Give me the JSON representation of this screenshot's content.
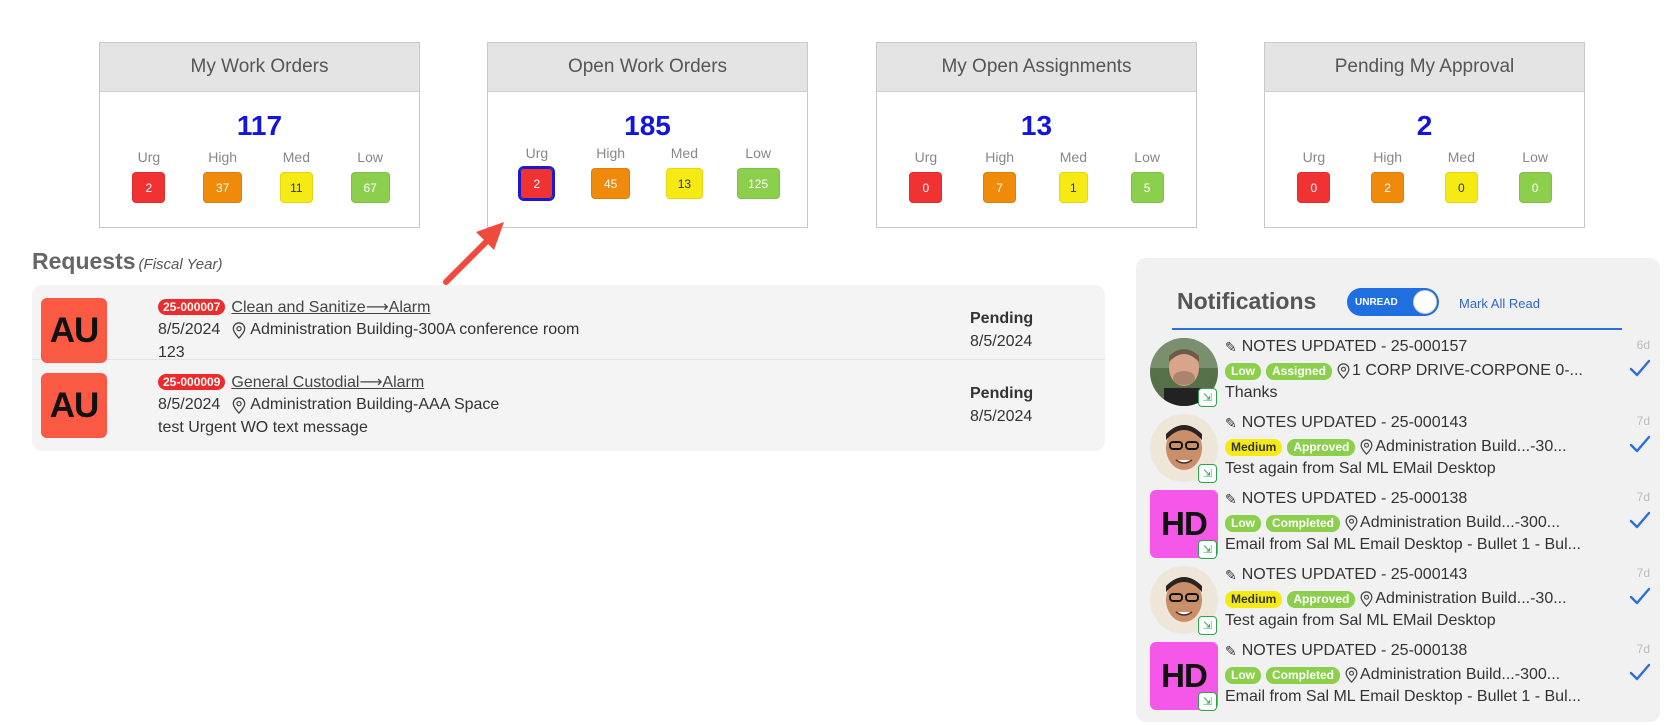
{
  "cards": [
    {
      "title": "My Work Orders",
      "total": "117",
      "labels": [
        "Urg",
        "High",
        "Med",
        "Low"
      ],
      "values": [
        "2",
        "37",
        "11",
        "67"
      ]
    },
    {
      "title": "Open Work Orders",
      "total": "185",
      "labels": [
        "Urg",
        "High",
        "Med",
        "Low"
      ],
      "values": [
        "2",
        "45",
        "13",
        "125"
      ]
    },
    {
      "title": "My Open Assignments",
      "total": "13",
      "labels": [
        "Urg",
        "High",
        "Med",
        "Low"
      ],
      "values": [
        "0",
        "7",
        "1",
        "5"
      ]
    },
    {
      "title": "Pending My Approval",
      "total": "2",
      "labels": [
        "Urg",
        "High",
        "Med",
        "Low"
      ],
      "values": [
        "0",
        "2",
        "0",
        "0"
      ]
    }
  ],
  "requests": {
    "title": "Requests",
    "subtitle": "(Fiscal Year)",
    "items": [
      {
        "avatar": "AU",
        "wo": "25-000007",
        "link": "Clean and Sanitize⟶Alarm",
        "date": "8/5/2024",
        "location": "Administration Building-300A conference room",
        "note": "123",
        "status": "Pending",
        "status_date": "8/5/2024"
      },
      {
        "avatar": "AU",
        "wo": "25-000009",
        "link": "General Custodial⟶Alarm",
        "date": "8/5/2024",
        "location": "Administration Building-AAA Space",
        "note": "test Urgent WO text message",
        "status": "Pending",
        "status_date": "8/5/2024"
      }
    ]
  },
  "notifications": {
    "title": "Notifications",
    "toggle_label": "UNREAD",
    "mark_all": "Mark All Read",
    "items": [
      {
        "avatar_type": "photo1",
        "heading": "NOTES UPDATED - 25-000157",
        "priority": "Low",
        "status": "Assigned",
        "location": "1 CORP DRIVE-CORPONE 0-...",
        "message": "Thanks",
        "age": "6d"
      },
      {
        "avatar_type": "photo2",
        "heading": "NOTES UPDATED - 25-000143",
        "priority": "Medium",
        "status": "Approved",
        "location": "Administration Build...-30...",
        "message": "Test again from Sal ML EMail Desktop",
        "age": "7d"
      },
      {
        "avatar_type": "HD",
        "heading": "NOTES UPDATED - 25-000138",
        "priority": "Low",
        "status": "Completed",
        "location": "Administration Build...-300...",
        "message": "Email from Sal ML Email Desktop - Bullet 1 - Bul...",
        "age": "7d"
      },
      {
        "avatar_type": "photo2",
        "heading": "NOTES UPDATED - 25-000143",
        "priority": "Medium",
        "status": "Approved",
        "location": "Administration Build...-30...",
        "message": "Test again from Sal ML EMail Desktop",
        "age": "7d"
      },
      {
        "avatar_type": "HD",
        "heading": "NOTES UPDATED - 25-000138",
        "priority": "Low",
        "status": "Completed",
        "location": "Administration Build...-300...",
        "message": "Email from Sal ML Email Desktop - Bullet 1 - Bul...",
        "age": "7d"
      }
    ]
  },
  "colors": {
    "urgent": "#f03232",
    "high": "#f08a0a",
    "medium": "#f6ea14",
    "low": "#8ccf4d",
    "total": "#1414e0",
    "accent": "#1f6fe0"
  }
}
